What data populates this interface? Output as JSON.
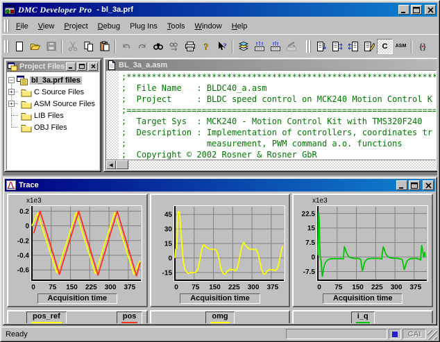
{
  "window": {
    "title_app": "DMC Developer Pro",
    "title_doc": "- bl_3a.prf"
  },
  "menu": {
    "items": [
      {
        "label": "File",
        "u": 0
      },
      {
        "label": "View",
        "u": 0
      },
      {
        "label": "Project",
        "u": 0
      },
      {
        "label": "Debug",
        "u": 0
      },
      {
        "label": "Plug Ins",
        "u": 3
      },
      {
        "label": "Tools",
        "u": 0
      },
      {
        "label": "Window",
        "u": 0
      },
      {
        "label": "Help",
        "u": 0
      }
    ]
  },
  "toolbar": {
    "main": [
      {
        "name": "new-file"
      },
      {
        "name": "open-file"
      },
      {
        "name": "save-file",
        "disabled": true
      },
      {
        "type": "sep"
      },
      {
        "name": "cut",
        "disabled": true
      },
      {
        "name": "copy"
      },
      {
        "name": "paste"
      },
      {
        "type": "sep"
      },
      {
        "name": "undo",
        "disabled": true
      },
      {
        "name": "redo",
        "disabled": true
      },
      {
        "name": "find"
      },
      {
        "name": "find-next",
        "disabled": true
      },
      {
        "name": "print"
      },
      {
        "name": "help"
      },
      {
        "name": "context-help"
      },
      {
        "type": "sep"
      },
      {
        "name": "build-options"
      },
      {
        "name": "build-all"
      },
      {
        "name": "build"
      },
      {
        "name": "build-stop",
        "disabled": true
      }
    ],
    "right": [
      {
        "name": "list-down"
      },
      {
        "name": "doc-right"
      },
      {
        "name": "doc-left"
      },
      {
        "name": "doc-edit"
      },
      {
        "name": "c-mode",
        "label": "C",
        "pressed": true
      },
      {
        "name": "asm-mode",
        "label": "ASM"
      },
      {
        "type": "sep"
      },
      {
        "name": "plugin-braces"
      }
    ]
  },
  "project_panel": {
    "title": "Project Files",
    "root_label": "bl_3a.prf files",
    "items": [
      {
        "label": "C Source Files",
        "plus": true
      },
      {
        "label": "ASM Source Files",
        "plus": true
      },
      {
        "label": "LIB Files",
        "plus": false
      },
      {
        "label": "OBJ Files",
        "plus": false
      }
    ]
  },
  "editor": {
    "title": "BL_3a_a.asm",
    "lines": [
      ";******************************************************************************",
      ";  File Name   : BLDC40_a.asm",
      ";  Project     : BLDC speed control on MCK240 Motion Control K",
      ";==============================================================================",
      ";  Target Sys  : MCK240 - Motion Control Kit with TMS320F240",
      ";  Description : Implementation of controllers, coordinates tr",
      ";                measurement, PWM command a.o. functions",
      ";  Copyright © 2002 Rosner & Rosner GbR"
    ]
  },
  "trace": {
    "title": "Trace",
    "xlabel": "Acquisition time",
    "legend_sections": [
      [
        {
          "label": "pos_ref",
          "color": "#ffff00"
        },
        {
          "label": "pos",
          "color": "#ff3020"
        }
      ],
      [
        {
          "label": "omg",
          "color": "#ffff00"
        }
      ],
      [
        {
          "label": "i_q",
          "color": "#00c800"
        }
      ]
    ]
  },
  "chart_data": [
    {
      "type": "line",
      "unit_label": "x1e3",
      "xlabel": "Acquisition time",
      "xlim": [
        0,
        424
      ],
      "xticks": [
        0,
        75,
        150,
        225,
        300,
        375
      ],
      "ylim": [
        -0.74,
        0.26
      ],
      "yticks": [
        0.2,
        0,
        -0.2,
        -0.4,
        -0.6
      ],
      "grid": true,
      "series": [
        {
          "name": "pos_ref",
          "color": "#ffff00",
          "points": [
            [
              0,
              0
            ],
            [
              22,
              0.17
            ],
            [
              97,
              -0.64
            ],
            [
              172,
              0.18
            ],
            [
              247,
              -0.65
            ],
            [
              322,
              0.18
            ],
            [
              397,
              -0.66
            ],
            [
              421,
              -0.47
            ]
          ]
        },
        {
          "name": "pos",
          "color": "#ff3020",
          "points": [
            [
              7,
              -0.1
            ],
            [
              32,
              0.2
            ],
            [
              107,
              -0.66
            ],
            [
              182,
              0.2
            ],
            [
              257,
              -0.67
            ],
            [
              332,
              0.2
            ],
            [
              407,
              -0.68
            ],
            [
              421,
              -0.5
            ]
          ]
        }
      ]
    },
    {
      "type": "line",
      "unit_label": "",
      "xlabel": "Acquisition time",
      "xlim": [
        0,
        424
      ],
      "xticks": [
        0,
        75,
        150,
        225,
        300,
        375
      ],
      "ylim": [
        -23,
        53
      ],
      "yticks": [
        45,
        30,
        15,
        0,
        -15
      ],
      "grid": true,
      "series": [
        {
          "name": "omg",
          "color": "#ffff00",
          "points": [
            [
              0,
              0
            ],
            [
              3,
              9
            ],
            [
              7,
              10
            ],
            [
              9,
              24
            ],
            [
              11,
              46
            ],
            [
              14,
              48
            ],
            [
              18,
              47
            ],
            [
              21,
              38
            ],
            [
              25,
              22
            ],
            [
              29,
              8
            ],
            [
              33,
              -4
            ],
            [
              38,
              -11
            ],
            [
              44,
              -14
            ],
            [
              52,
              -16
            ],
            [
              60,
              -15
            ],
            [
              70,
              -15
            ],
            [
              80,
              -15
            ],
            [
              87,
              -13
            ],
            [
              92,
              -9
            ],
            [
              97,
              -2
            ],
            [
              102,
              6
            ],
            [
              107,
              11
            ],
            [
              112,
              14
            ],
            [
              117,
              13
            ],
            [
              123,
              11
            ],
            [
              130,
              10
            ],
            [
              138,
              9
            ],
            [
              147,
              9
            ],
            [
              156,
              9
            ],
            [
              163,
              7
            ],
            [
              168,
              3
            ],
            [
              173,
              -3
            ],
            [
              178,
              -9
            ],
            [
              183,
              -14
            ],
            [
              189,
              -16
            ],
            [
              194,
              -17
            ],
            [
              200,
              -15
            ],
            [
              206,
              -13
            ],
            [
              212,
              -12
            ],
            [
              220,
              -12
            ],
            [
              228,
              -12
            ],
            [
              234,
              -13
            ],
            [
              240,
              -12
            ],
            [
              245,
              -8
            ],
            [
              250,
              -2
            ],
            [
              255,
              5
            ],
            [
              260,
              11
            ],
            [
              265,
              15
            ],
            [
              269,
              16
            ],
            [
              273,
              14
            ],
            [
              279,
              12
            ],
            [
              286,
              10
            ],
            [
              294,
              9
            ],
            [
              303,
              9
            ],
            [
              312,
              9
            ],
            [
              318,
              8
            ],
            [
              324,
              4
            ],
            [
              329,
              -2
            ],
            [
              334,
              -8
            ],
            [
              339,
              -13
            ],
            [
              344,
              -16
            ],
            [
              349,
              -17
            ],
            [
              355,
              -15
            ],
            [
              361,
              -13
            ],
            [
              367,
              -12
            ],
            [
              375,
              -12
            ],
            [
              383,
              -12
            ],
            [
              389,
              -13
            ],
            [
              395,
              -12
            ],
            [
              400,
              -10
            ],
            [
              405,
              -5
            ],
            [
              410,
              2
            ],
            [
              415,
              8
            ],
            [
              419,
              12
            ]
          ]
        }
      ]
    },
    {
      "type": "line",
      "unit_label": "x1e3",
      "xlabel": "Acquisition time",
      "xlim": [
        0,
        424
      ],
      "xticks": [
        0,
        75,
        150,
        225,
        300,
        375
      ],
      "ylim": [
        -12,
        26
      ],
      "yticks": [
        22.5,
        15,
        7.5,
        0,
        -7.5
      ],
      "grid": true,
      "series": [
        {
          "name": "i_q",
          "color": "#00c800",
          "points": [
            [
              0,
              1
            ],
            [
              2,
              17
            ],
            [
              3,
              23
            ],
            [
              5,
              19
            ],
            [
              7,
              8
            ],
            [
              9,
              1
            ],
            [
              11,
              -1
            ],
            [
              13,
              -2
            ],
            [
              15,
              -7
            ],
            [
              17,
              -10
            ],
            [
              19,
              -9
            ],
            [
              22,
              -6
            ],
            [
              26,
              -4
            ],
            [
              31,
              -2.5
            ],
            [
              38,
              -1.5
            ],
            [
              47,
              -1
            ],
            [
              58,
              -0.8
            ],
            [
              72,
              -0.8
            ],
            [
              88,
              -0.8
            ],
            [
              99,
              -1
            ],
            [
              101,
              2
            ],
            [
              103,
              5.3
            ],
            [
              106,
              4.5
            ],
            [
              110,
              2.8
            ],
            [
              115,
              1.2
            ],
            [
              121,
              0.2
            ],
            [
              129,
              -0.4
            ],
            [
              142,
              -0.7
            ],
            [
              158,
              -0.7
            ],
            [
              167,
              -1.2
            ],
            [
              170,
              -4
            ],
            [
              173,
              -7
            ],
            [
              176,
              -6
            ],
            [
              180,
              -3.5
            ],
            [
              186,
              -1.8
            ],
            [
              194,
              -1
            ],
            [
              207,
              -0.7
            ],
            [
              222,
              -0.7
            ],
            [
              238,
              -0.7
            ],
            [
              249,
              -1
            ],
            [
              251,
              2
            ],
            [
              254,
              5.3
            ],
            [
              257,
              4.5
            ],
            [
              261,
              2.8
            ],
            [
              266,
              1.2
            ],
            [
              273,
              0.2
            ],
            [
              282,
              -0.4
            ],
            [
              296,
              -0.7
            ],
            [
              312,
              -0.7
            ],
            [
              328,
              -1.2
            ],
            [
              332,
              -3.5
            ],
            [
              336,
              -6.5
            ],
            [
              339,
              -5.5
            ],
            [
              343,
              -3.5
            ],
            [
              349,
              -1.8
            ],
            [
              357,
              -1
            ],
            [
              370,
              -0.7
            ],
            [
              385,
              -0.7
            ],
            [
              396,
              -1.2
            ],
            [
              400,
              -1.5
            ],
            [
              402,
              3
            ],
            [
              404,
              6
            ],
            [
              407,
              4
            ],
            [
              410,
              1.5
            ],
            [
              412,
              0
            ],
            [
              414,
              1.8
            ],
            [
              416,
              2.5
            ],
            [
              418,
              0.3
            ]
          ]
        }
      ]
    }
  ],
  "status": {
    "ready": "Ready",
    "cai": "CAI",
    "indicator_color": "#2020cc"
  }
}
